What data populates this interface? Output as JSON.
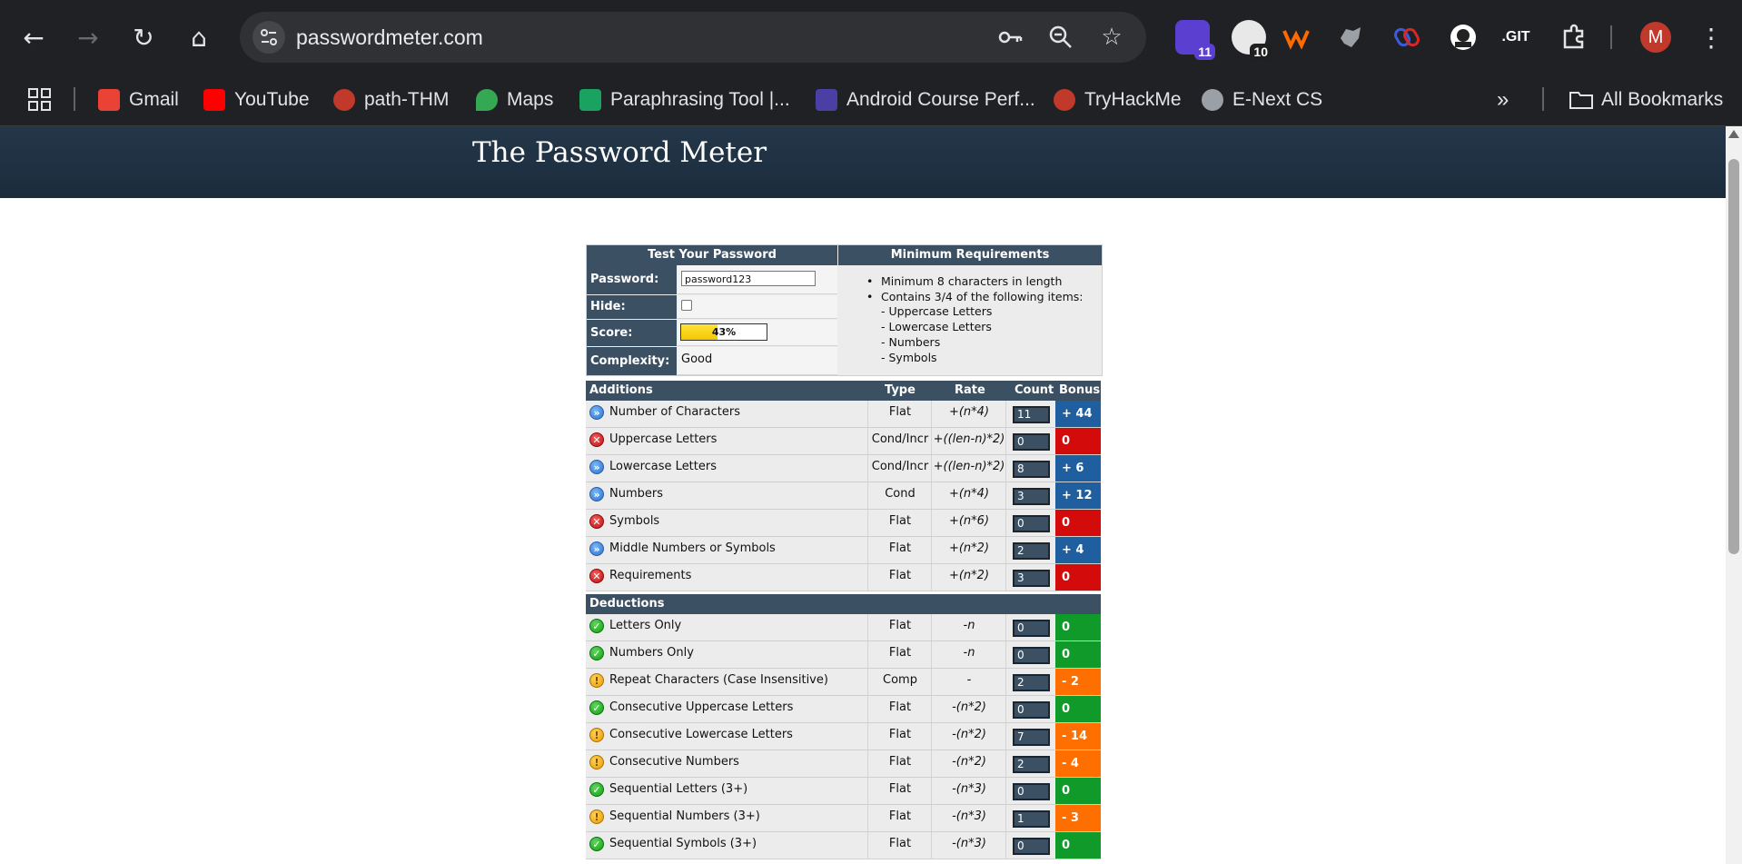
{
  "browser": {
    "url": "passwordmeter.com",
    "avatar_initial": "M",
    "extension_badges": [
      "11",
      "10"
    ],
    "bookmarks": [
      {
        "label": "Gmail",
        "color": "#ea4335"
      },
      {
        "label": "YouTube",
        "color": "#ff0000"
      },
      {
        "label": "path-THM",
        "color": "#c0392b"
      },
      {
        "label": "Maps",
        "color": "#34a853"
      },
      {
        "label": "Paraphrasing Tool |...",
        "color": "#1aa260"
      },
      {
        "label": "Android Course Perf...",
        "color": "#4b3fa6"
      },
      {
        "label": "TryHackMe",
        "color": "#c0392b"
      },
      {
        "label": "E-Next CS",
        "color": "#9aa0a6"
      }
    ],
    "all_bookmarks_label": "All Bookmarks"
  },
  "page": {
    "title": "The Password Meter"
  },
  "test_panel": {
    "header": "Test Your Password",
    "password_label": "Password:",
    "password_value": "password123",
    "hide_label": "Hide:",
    "score_label": "Score:",
    "score_text": "43%",
    "score_fraction": 0.43,
    "complexity_label": "Complexity:",
    "complexity_value": "Good"
  },
  "requirements": {
    "header": "Minimum Requirements",
    "items": [
      "Minimum 8 characters in length",
      "Contains 3/4 of the following items:"
    ],
    "sub_items": [
      "- Uppercase Letters",
      "- Lowercase Letters",
      "- Numbers",
      "- Symbols"
    ]
  },
  "table": {
    "additions_header": "Additions",
    "type_header": "Type",
    "rate_header": "Rate",
    "count_header": "Count",
    "bonus_header": "Bonus",
    "deductions_header": "Deductions",
    "additions": [
      {
        "name": "Number of Characters",
        "type": "Flat",
        "rate": "+(n*4)",
        "count": "11",
        "bonus": "+ 44",
        "status": "info",
        "bonus_color": "blue"
      },
      {
        "name": "Uppercase Letters",
        "type": "Cond/Incr",
        "rate": "+((len-n)*2)",
        "count": "0",
        "bonus": "0",
        "status": "fail",
        "bonus_color": "red"
      },
      {
        "name": "Lowercase Letters",
        "type": "Cond/Incr",
        "rate": "+((len-n)*2)",
        "count": "8",
        "bonus": "+ 6",
        "status": "info",
        "bonus_color": "blue"
      },
      {
        "name": "Numbers",
        "type": "Cond",
        "rate": "+(n*4)",
        "count": "3",
        "bonus": "+ 12",
        "status": "info",
        "bonus_color": "blue"
      },
      {
        "name": "Symbols",
        "type": "Flat",
        "rate": "+(n*6)",
        "count": "0",
        "bonus": "0",
        "status": "fail",
        "bonus_color": "red"
      },
      {
        "name": "Middle Numbers or Symbols",
        "type": "Flat",
        "rate": "+(n*2)",
        "count": "2",
        "bonus": "+ 4",
        "status": "info",
        "bonus_color": "blue"
      },
      {
        "name": "Requirements",
        "type": "Flat",
        "rate": "+(n*2)",
        "count": "3",
        "bonus": "0",
        "status": "fail",
        "bonus_color": "red"
      }
    ],
    "deductions": [
      {
        "name": "Letters Only",
        "type": "Flat",
        "rate": "-n",
        "count": "0",
        "bonus": "0",
        "status": "pass",
        "bonus_color": "green"
      },
      {
        "name": "Numbers Only",
        "type": "Flat",
        "rate": "-n",
        "count": "0",
        "bonus": "0",
        "status": "pass",
        "bonus_color": "green"
      },
      {
        "name": "Repeat Characters (Case Insensitive)",
        "type": "Comp",
        "rate": "-",
        "count": "2",
        "bonus": "- 2",
        "status": "warn",
        "bonus_color": "orange"
      },
      {
        "name": "Consecutive Uppercase Letters",
        "type": "Flat",
        "rate": "-(n*2)",
        "count": "0",
        "bonus": "0",
        "status": "pass",
        "bonus_color": "green"
      },
      {
        "name": "Consecutive Lowercase Letters",
        "type": "Flat",
        "rate": "-(n*2)",
        "count": "7",
        "bonus": "- 14",
        "status": "warn",
        "bonus_color": "orange"
      },
      {
        "name": "Consecutive Numbers",
        "type": "Flat",
        "rate": "-(n*2)",
        "count": "2",
        "bonus": "- 4",
        "status": "warn",
        "bonus_color": "orange"
      },
      {
        "name": "Sequential Letters (3+)",
        "type": "Flat",
        "rate": "-(n*3)",
        "count": "0",
        "bonus": "0",
        "status": "pass",
        "bonus_color": "green"
      },
      {
        "name": "Sequential Numbers (3+)",
        "type": "Flat",
        "rate": "-(n*3)",
        "count": "1",
        "bonus": "- 3",
        "status": "warn",
        "bonus_color": "orange"
      },
      {
        "name": "Sequential Symbols (3+)",
        "type": "Flat",
        "rate": "-(n*3)",
        "count": "0",
        "bonus": "0",
        "status": "pass",
        "bonus_color": "green"
      }
    ]
  }
}
